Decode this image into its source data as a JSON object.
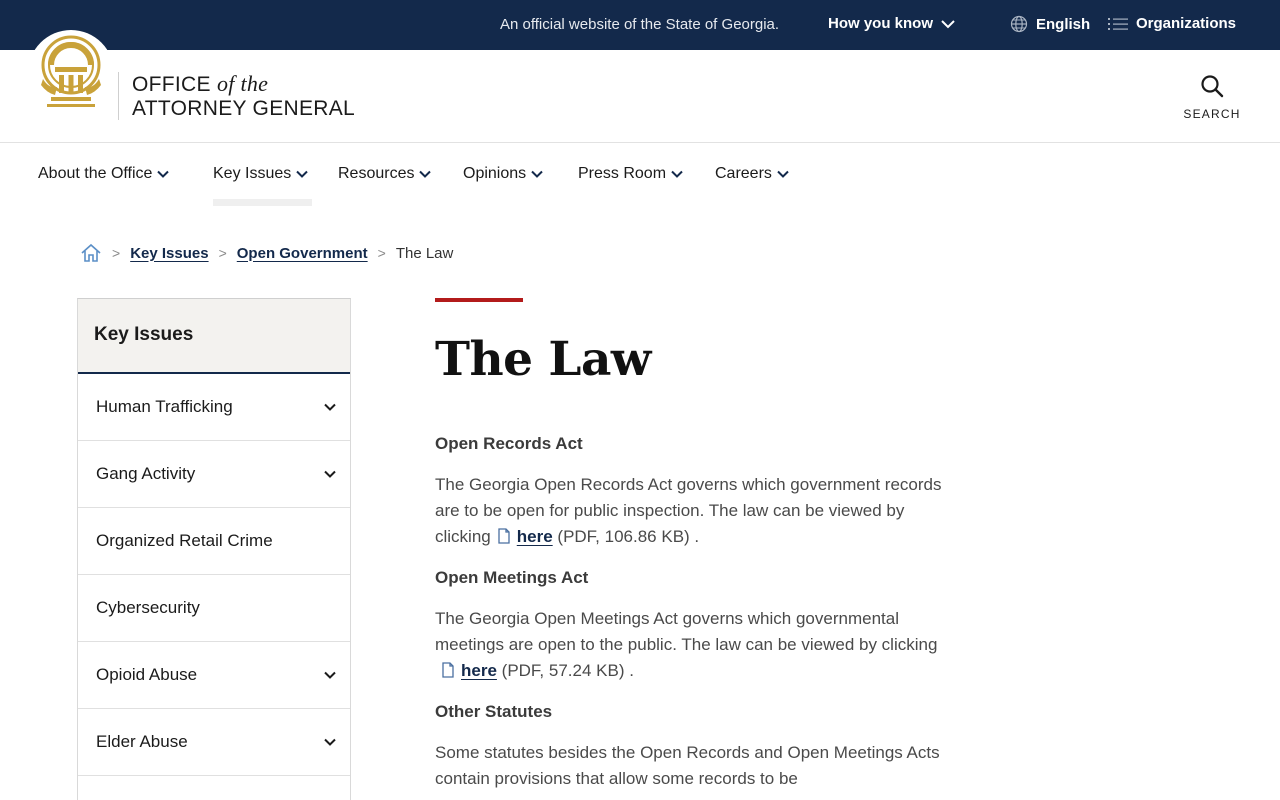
{
  "topbar": {
    "official": "An official website of the State of Georgia.",
    "how_you_know": "How you know",
    "language": "English",
    "organizations": "Organizations"
  },
  "header": {
    "brand_line1_a": "OFFICE",
    "brand_line1_b": "of the",
    "brand_line2": "ATTORNEY GENERAL",
    "search_label": "SEARCH"
  },
  "nav": {
    "items": [
      {
        "label": "About the Office"
      },
      {
        "label": "Key Issues"
      },
      {
        "label": "Resources"
      },
      {
        "label": "Opinions"
      },
      {
        "label": "Press Room"
      },
      {
        "label": "Careers"
      }
    ]
  },
  "breadcrumb": {
    "items": [
      "Key Issues",
      "Open Government"
    ],
    "current": "The Law"
  },
  "sidebar": {
    "title": "Key Issues",
    "items": [
      {
        "label": "Human Trafficking"
      },
      {
        "label": "Gang Activity"
      },
      {
        "label": "Organized Retail Crime"
      },
      {
        "label": "Cybersecurity"
      },
      {
        "label": "Opioid Abuse"
      },
      {
        "label": "Elder Abuse"
      }
    ]
  },
  "main": {
    "title": "The Law",
    "sections": [
      {
        "heading": "Open Records Act",
        "text": "The Georgia Open Records Act governs which government records are to be open for public inspection. The law can be viewed by clicking",
        "link": "here",
        "meta": "(PDF, 106.86 KB) ."
      },
      {
        "heading": "Open Meetings Act",
        "text": "The Georgia Open Meetings Act governs which governmental meetings are open to the public. The law can be viewed by clicking",
        "link": "here",
        "meta": "(PDF, 57.24 KB) ."
      },
      {
        "heading": "Other Statutes",
        "text": "Some statutes besides the Open Records and Open Meetings Acts contain provisions that allow some records to be"
      }
    ]
  },
  "colors": {
    "navy": "#13294b",
    "accent_red": "#b31b1b",
    "gold": "#c9a23a"
  }
}
